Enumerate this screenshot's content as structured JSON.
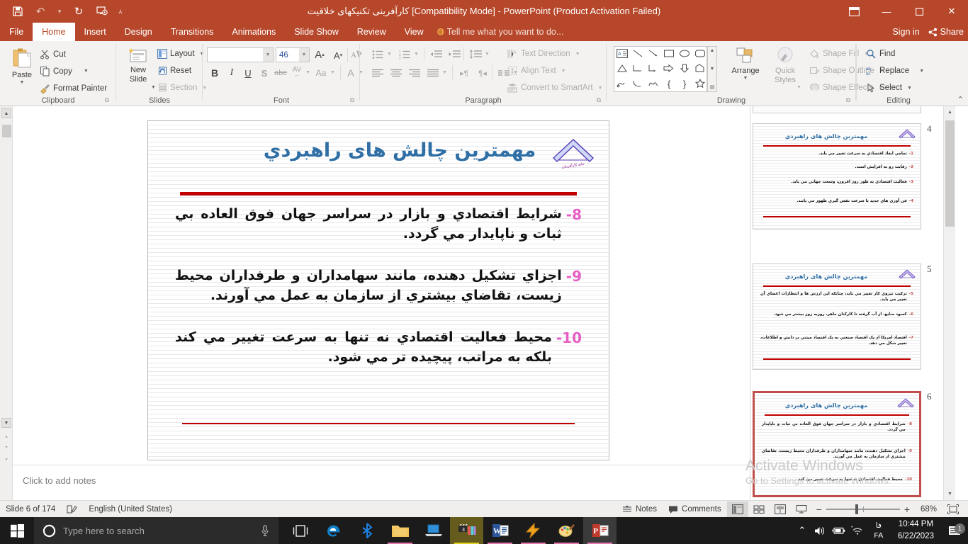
{
  "titlebar": {
    "title": "کارآفرینی تکنیکهای خلاقیت [Compatibility Mode]  -  PowerPoint (Product Activation Failed)",
    "qat": [
      {
        "name": "save",
        "glyph": "Ὃe"
      },
      {
        "name": "undo",
        "glyph": "↶"
      },
      {
        "name": "redo",
        "glyph": "↻"
      },
      {
        "name": "start-slideshow",
        "glyph": "▷"
      },
      {
        "name": "customize-qat",
        "glyph": "▾"
      }
    ],
    "window": {
      "restore": "❐",
      "minimize": "—",
      "maximize": "❐",
      "close": "✕"
    }
  },
  "ribbon": {
    "tabs": [
      {
        "label": "File"
      },
      {
        "label": "Home"
      },
      {
        "label": "Insert"
      },
      {
        "label": "Design"
      },
      {
        "label": "Transitions"
      },
      {
        "label": "Animations"
      },
      {
        "label": "Slide Show"
      },
      {
        "label": "Review"
      },
      {
        "label": "View"
      }
    ],
    "active_tab": "Home",
    "tellme": "Tell me what you want to do...",
    "signin": "Sign in",
    "share": "Share",
    "groups": {
      "clipboard": {
        "label": "Clipboard",
        "paste": "Paste",
        "cut": "Cut",
        "copy": "Copy",
        "format_painter": "Format Painter"
      },
      "slides": {
        "label": "Slides",
        "new_slide": "New\nSlide",
        "new_slide_l1": "New",
        "new_slide_l2": "Slide",
        "layout": "Layout",
        "reset": "Reset",
        "section": "Section"
      },
      "font": {
        "label": "Font",
        "font_name": "",
        "font_size": "46",
        "bold": "B",
        "italic": "I",
        "underline": "U",
        "shadow": "S",
        "strikethrough": "abc",
        "character_spacing": "AV",
        "change_case": "Aa",
        "font_color": "A",
        "increase_size": "A",
        "decrease_size": "A",
        "clear_formatting": "clear-formatting-icon"
      },
      "paragraph": {
        "label": "Paragraph",
        "text_direction": "Text Direction",
        "align_text": "Align Text",
        "convert_to_smartart": "Convert to SmartArt"
      },
      "drawing": {
        "label": "Drawing",
        "arrange": "Arrange",
        "quick_styles_l1": "Quick",
        "quick_styles_l2": "Styles",
        "shape_fill": "Shape Fill",
        "shape_outline": "Shape Outline",
        "shape_effects": "Shape Effects"
      },
      "editing": {
        "label": "Editing",
        "find": "Find",
        "replace": "Replace",
        "select": "Select"
      }
    }
  },
  "slide": {
    "title": "مهمترین چالش های راهبردي",
    "logo_caption": "خانه کارآفرینان",
    "bullets": [
      {
        "num": "8-",
        "text": "شرایط اقتصادي و بازار در سراسر جهان فوق العاده بي ثبات و ناپایدار مي گردد."
      },
      {
        "num": "9-",
        "text": "اجزاي تشکیل دهنده، مانند سهامداران و طرفداران محیط زیست، تقاضاي بیشتري از سازمان به عمل مي آورند."
      },
      {
        "num": "10-",
        "text": "محیط فعالیت اقتصادي نه تنها به سرعت تغییر مي کند بلکه به مراتب، پیچیده تر مي شود."
      }
    ]
  },
  "notes": {
    "placeholder": "Click to add notes"
  },
  "watermark": {
    "line1": "Activate Windows",
    "line2": "Go to Settings to activate Windows."
  },
  "thumbnails": [
    {
      "number": "4",
      "title": "مهمترین چالش های راهبردي",
      "selected": false,
      "items": [
        {
          "num": "1-",
          "text": "تمامي ابعاد اقتصادي به سرعت تغییر مي یابد."
        },
        {
          "num": "2-",
          "text": "رقابت رو به افزایش است."
        },
        {
          "num": "3-",
          "text": "فعالیت اقتصادي به طور روز افزون، وسعت جهاني مي یابد."
        },
        {
          "num": "4-",
          "text": "فن آوري هاي جدید با سرعت نفس گیري ظهور مي یابند."
        }
      ]
    },
    {
      "number": "5",
      "title": "مهمترین چالش های راهبردي",
      "selected": false,
      "items": [
        {
          "num": "5-",
          "text": "ترکیب نیروي کار تغییر مي یابد، چنانکه این ارزش ها و انتظارات اعضاي آن تغییر مي یابد."
        },
        {
          "num": "6-",
          "text": "کمبود منابع، از آب گرفته تا کارکنان ماهر، روزبه روز بیشتر مي شود."
        },
        {
          "num": "7-",
          "text": "اقتصاد امریکا از یک اقتصاد صنعتي به یک اقتصاد مبتني بر دانش و اطلاعات، تغییر شکل مي دهد."
        }
      ]
    },
    {
      "number": "6",
      "title": "مهمترین چالش های راهبردي",
      "selected": true,
      "items": [
        {
          "num": "8-",
          "text": "شرایط اقتصادي و بازار در سراسر جهان فوق العاده بي ثبات و ناپایدار مي گردد."
        },
        {
          "num": "9-",
          "text": "اجزاي تشکیل دهنده، مانند سهامداران و طرفداران محیط زیست، تقاضاي بیشتري از سازمان به عمل مي آورند."
        },
        {
          "num": "10-",
          "text": "محیط فعالیت اقتصادي نه تنها به سرعت تغییر مي کند"
        }
      ]
    }
  ],
  "statusbar": {
    "slide_indicator": "Slide 6 of 174",
    "language": "English (United States)",
    "notes": "Notes",
    "comments": "Comments",
    "zoom_level": "68%"
  },
  "taskbar": {
    "search_placeholder": "Type here to search",
    "clock_time": "10:44 PM",
    "clock_date": "6/22/2023",
    "lang_top": "فا",
    "lang_bottom": "FA",
    "notification_count": "1",
    "apps": [
      {
        "name": "task-view-icon"
      },
      {
        "name": "edge-icon"
      },
      {
        "name": "bluetooth-icon"
      },
      {
        "name": "file-explorer-icon"
      },
      {
        "name": "remote-desktop-icon"
      },
      {
        "name": "media-app-icon"
      },
      {
        "name": "word-icon"
      },
      {
        "name": "winamp-icon"
      },
      {
        "name": "paint-icon"
      },
      {
        "name": "powerpoint-icon"
      }
    ]
  },
  "colors": {
    "accent": "#b7472a",
    "title_blue": "#2f6fa5",
    "rule_red": "#c00000",
    "bullet_pink": "#e75fc3"
  }
}
